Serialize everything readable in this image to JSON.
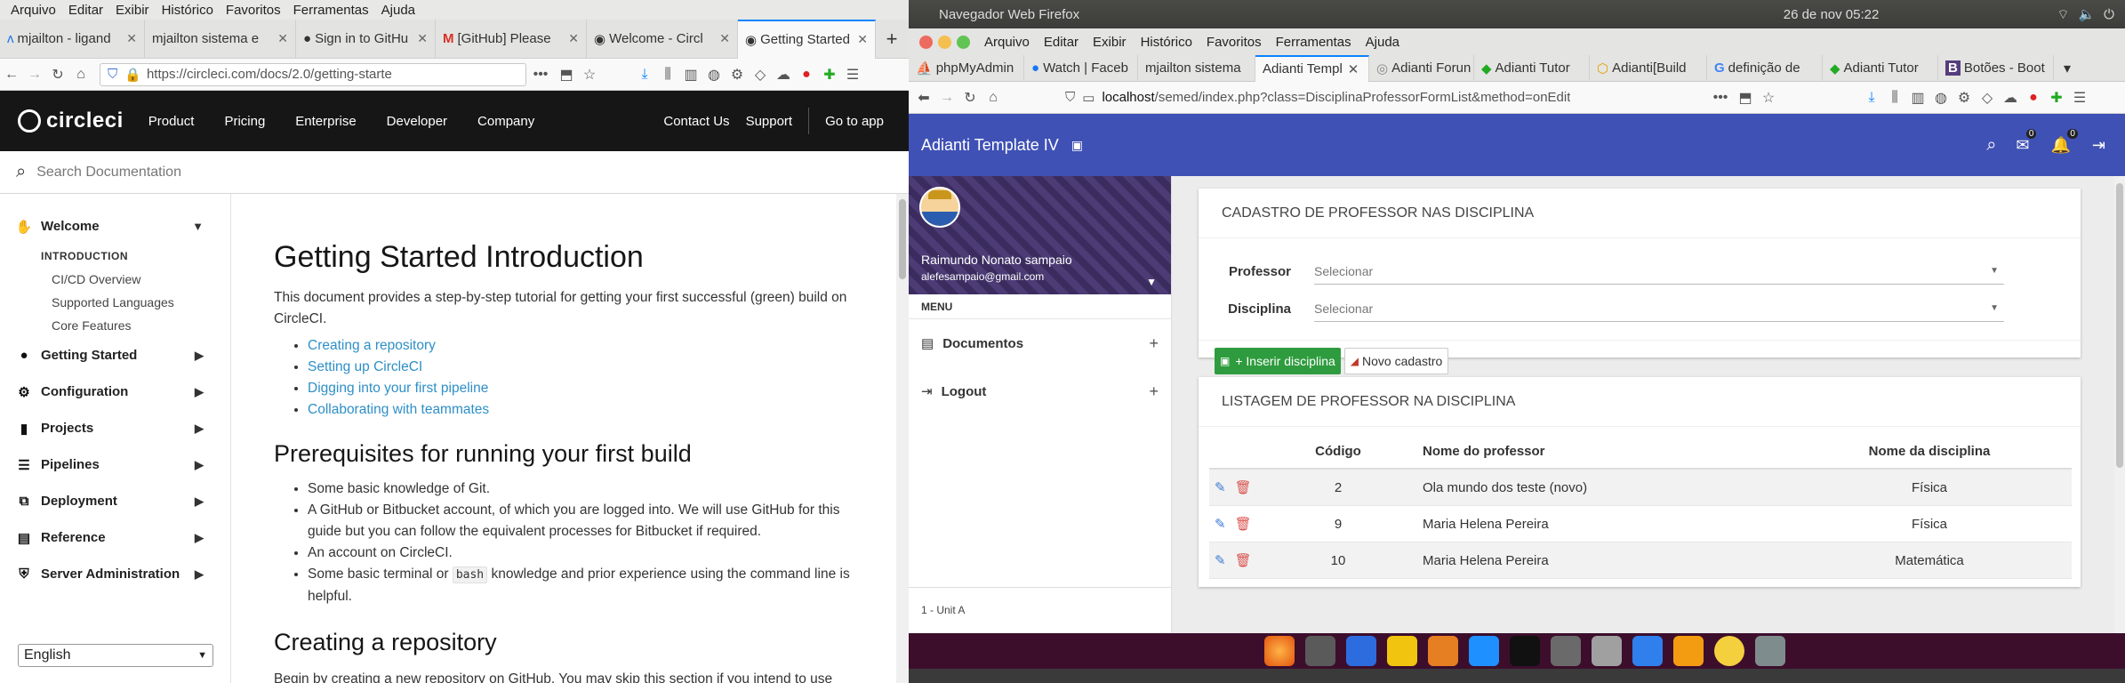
{
  "left_window": {
    "menubar": [
      "Arquivo",
      "Editar",
      "Exibir",
      "Histórico",
      "Favoritos",
      "Ferramentas",
      "Ajuda"
    ],
    "tabs": [
      {
        "label": "mjailton - ligand"
      },
      {
        "label": "mjailton sistema e"
      },
      {
        "label": "Sign in to GitHu"
      },
      {
        "label": "[GitHub] Please"
      },
      {
        "label": "Welcome - Circl"
      },
      {
        "label": "Getting Started"
      }
    ],
    "url": "https://circleci.com/docs/2.0/getting-starte",
    "url_more": "•••",
    "header": {
      "logo": "circleci",
      "nav": [
        "Product",
        "Pricing",
        "Enterprise",
        "Developer",
        "Company"
      ],
      "right": [
        "Contact Us",
        "Support",
        "Go to app"
      ]
    },
    "search": {
      "placeholder": "Search Documentation"
    },
    "sidebar": {
      "welcome": "Welcome",
      "intro_head": "INTRODUCTION",
      "intro_items": [
        "CI/CD Overview",
        "Supported Languages",
        "Core Features"
      ],
      "sections": [
        "Getting Started",
        "Configuration",
        "Projects",
        "Pipelines",
        "Deployment",
        "Reference",
        "Server Administration"
      ],
      "language": "English"
    },
    "content": {
      "title": "Getting Started Introduction",
      "intro": "This document provides a step-by-step tutorial for getting your first successful (green) build on CircleCI.",
      "toc": [
        "Creating a repository",
        "Setting up CircleCI",
        "Digging into your first pipeline",
        "Collaborating with teammates"
      ],
      "prereq_title": "Prerequisites for running your first build",
      "prereqs": [
        "Some basic knowledge of Git.",
        "A GitHub or Bitbucket account, of which you are logged into. We will use GitHub for this guide but you can follow the equivalent processes for Bitbucket if required.",
        "An account on CircleCI."
      ],
      "prereq_last_a": "Some basic terminal or",
      "prereq_last_code": "bash",
      "prereq_last_b": "knowledge and prior experience using the command line is helpful.",
      "repo_title": "Creating a repository",
      "repo_text": "Begin by creating a new repository on GitHub. You may skip this section if you intend to use"
    }
  },
  "right_window": {
    "topbar": {
      "title": "Navegador Web Firefox",
      "clock": "26 de nov  05:22"
    },
    "menubar": [
      "Arquivo",
      "Editar",
      "Exibir",
      "Histórico",
      "Favoritos",
      "Ferramentas",
      "Ajuda"
    ],
    "tabs": [
      {
        "label": "phpMyAdmin"
      },
      {
        "label": "Watch | Faceb"
      },
      {
        "label": "mjailton sistema"
      },
      {
        "label": "Adianti Templ"
      },
      {
        "label": "Adianti Forun"
      },
      {
        "label": "Adianti Tutor"
      },
      {
        "label": "Adianti[Build"
      },
      {
        "label": "definição de"
      },
      {
        "label": "Adianti Tutor"
      },
      {
        "label": "Botões - Boot"
      }
    ],
    "url_host": "localhost",
    "url_path": "/semed/index.php?class=DisciplinaProfessorFormList&method=onEdit",
    "url_more": "•••",
    "app": {
      "title": "Adianti Template IV",
      "badge_messages": "0",
      "badge_notifications": "0",
      "user_name": "Raimundo Nonato sampaio",
      "user_email": "alefesampaio@gmail.com",
      "menu_label": "MENU",
      "menu_items": [
        "Documentos",
        "Logout"
      ],
      "unit": "1 - Unit A"
    },
    "form": {
      "title": "CADASTRO DE PROFESSOR NAS DISCIPLINA",
      "professor_label": "Professor",
      "professor_placeholder": "Selecionar",
      "disciplina_label": "Disciplina",
      "disciplina_placeholder": "Selecionar",
      "btn_insert": "+ Inserir disciplina",
      "btn_new": "Novo cadastro"
    },
    "list": {
      "title": "LISTAGEM DE PROFESSOR NA DISCIPLINA",
      "columns": [
        "Código",
        "Nome do professor",
        "Nome da disciplina"
      ],
      "rows": [
        {
          "code": "2",
          "name": "Ola mundo dos teste (novo)",
          "disc": "Física"
        },
        {
          "code": "9",
          "name": "Maria Helena Pereira",
          "disc": "Física"
        },
        {
          "code": "10",
          "name": "Maria Helena Pereira",
          "disc": "Matemática"
        }
      ]
    }
  }
}
